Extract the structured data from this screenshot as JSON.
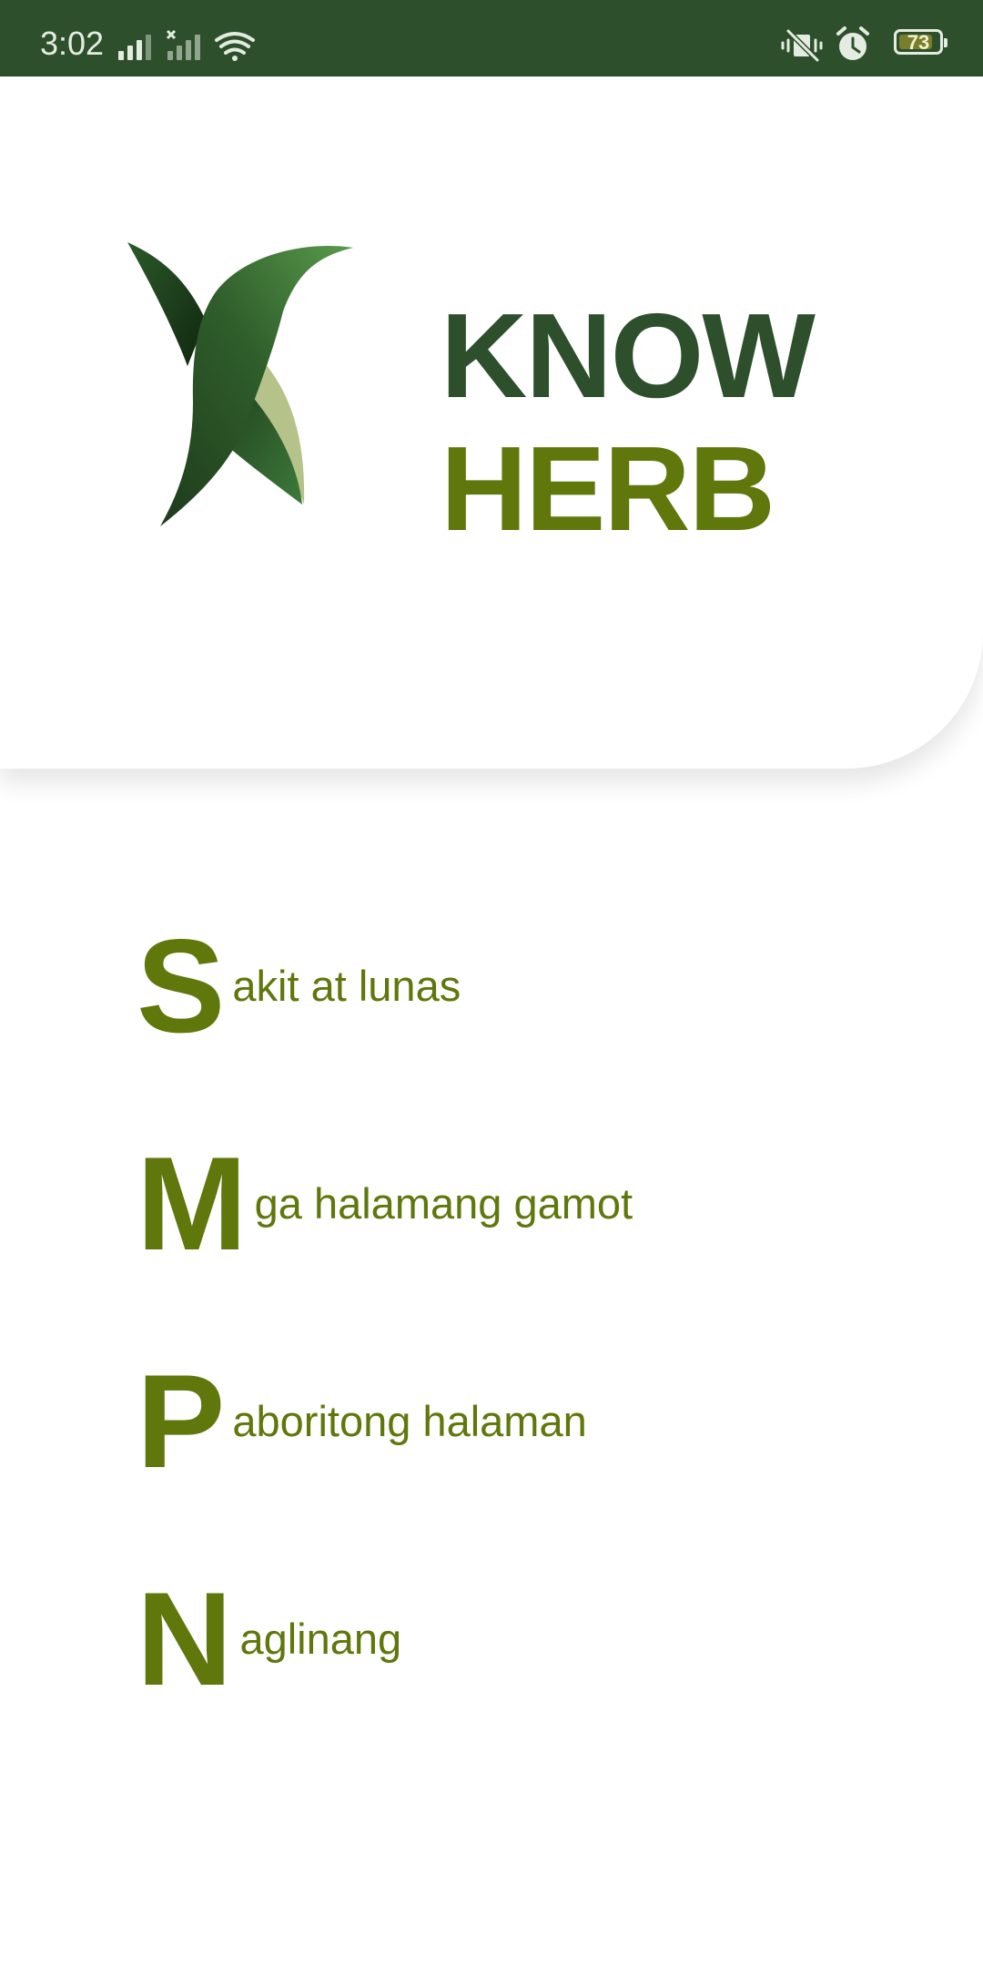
{
  "status_bar": {
    "time": "3:02",
    "battery": "73",
    "icons": [
      "signal-icon",
      "no-signal-icon",
      "wifi-icon",
      "vibrate-off-icon",
      "alarm-icon",
      "battery-icon"
    ]
  },
  "header": {
    "title_line1": "KNOW",
    "title_line2": "HERB",
    "logo_icon": "leaf-logo-icon"
  },
  "menu": {
    "items": [
      {
        "letter": "S",
        "rest": "akit at lunas"
      },
      {
        "letter": "M",
        "rest": "ga halamang gamot"
      },
      {
        "letter": "P",
        "rest": "aboritong halaman"
      },
      {
        "letter": "N",
        "rest": "aglinang"
      }
    ]
  },
  "colors": {
    "dark_green": "#2e4f2c",
    "olive_green": "#5f770b",
    "background": "#ffffff"
  }
}
